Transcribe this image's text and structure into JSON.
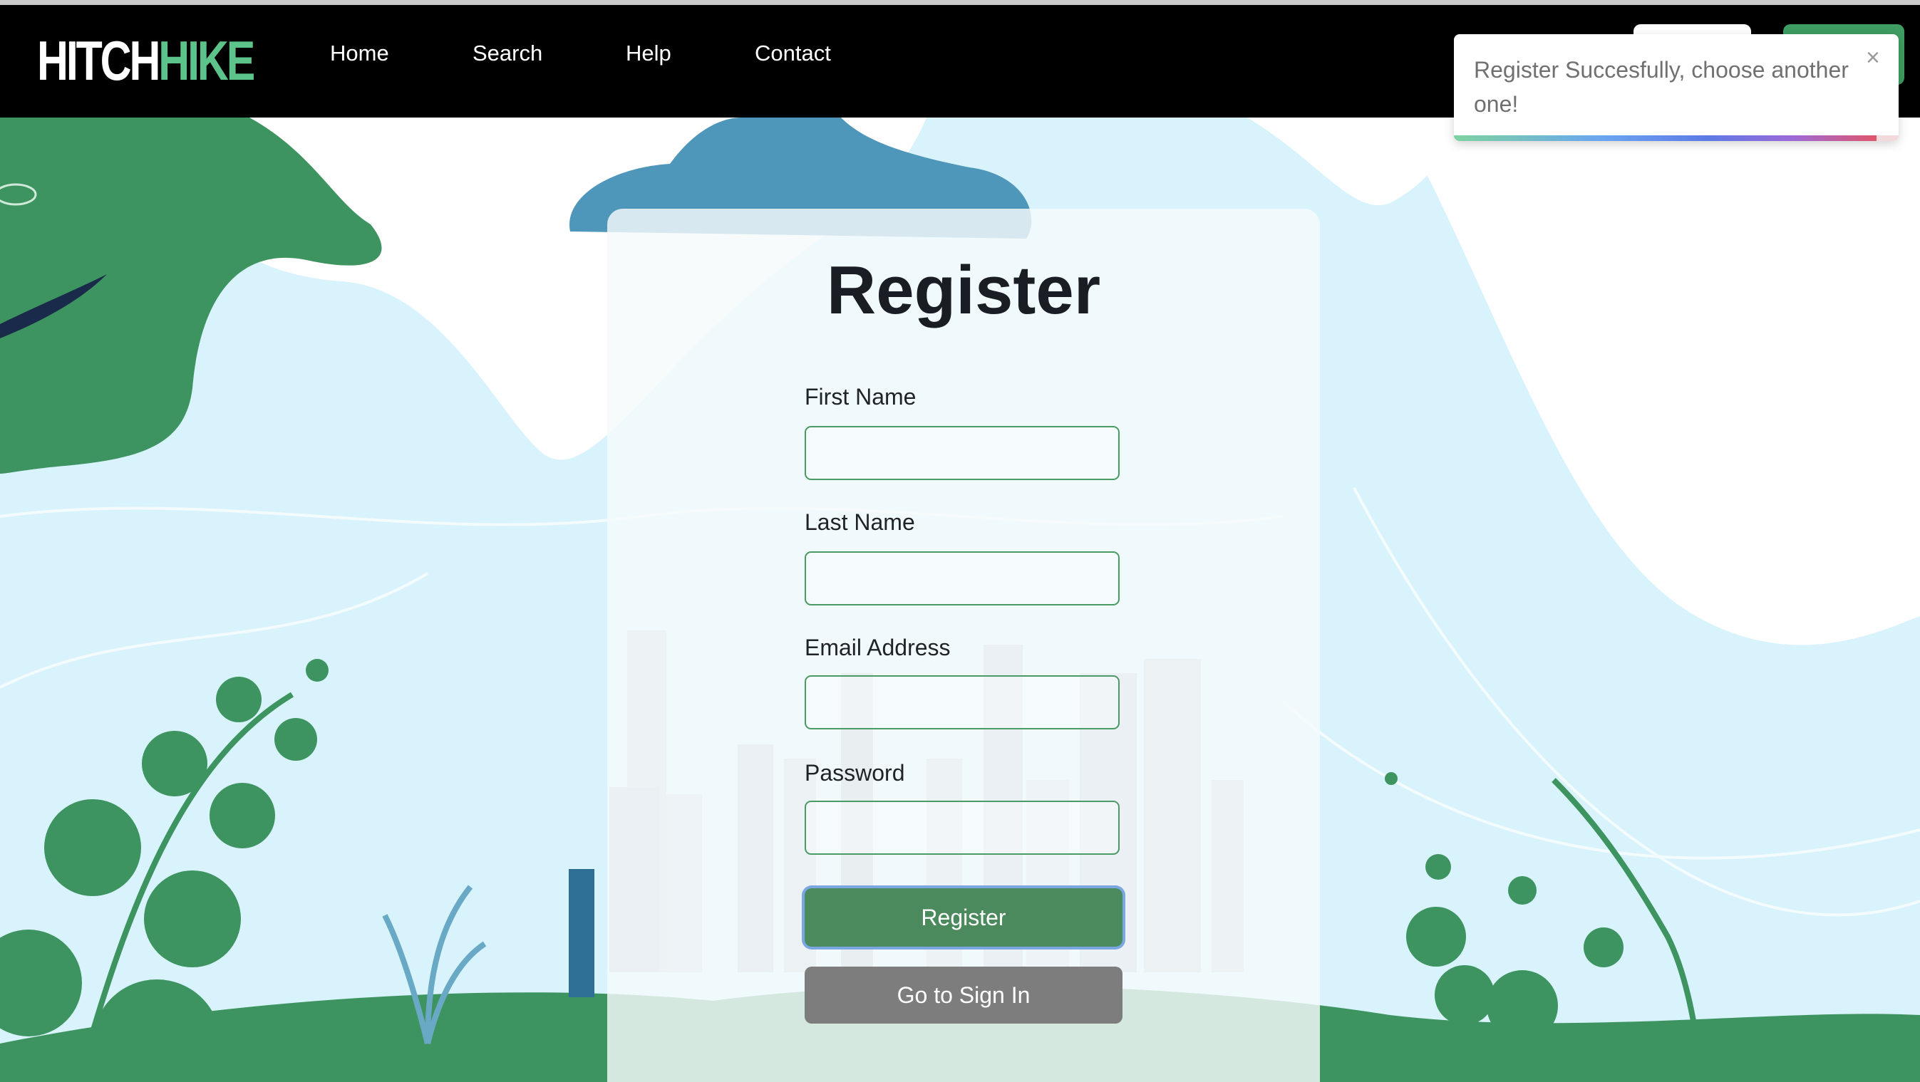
{
  "brand": {
    "logo_part1": "HITCH",
    "logo_part2": "HIKE"
  },
  "nav": {
    "items": [
      {
        "label": "Home"
      },
      {
        "label": "Search"
      },
      {
        "label": "Help"
      },
      {
        "label": "Contact"
      }
    ]
  },
  "register_form": {
    "title": "Register",
    "fields": [
      {
        "label": "First Name",
        "value": ""
      },
      {
        "label": "Last Name",
        "value": ""
      },
      {
        "label": "Email Address",
        "value": ""
      },
      {
        "label": "Password",
        "value": ""
      }
    ],
    "submit_label": "Register",
    "signin_label": "Go to Sign In"
  },
  "toast": {
    "message": "Register Succesfully, choose another one!",
    "close_symbol": "×",
    "progress": 0.95
  },
  "colors": {
    "navbar": "#000000",
    "brand_green": "#5cc48a",
    "button_green": "#4a8a5c",
    "button_gray": "#7d7d7d",
    "sky": "#d8f3fb"
  }
}
